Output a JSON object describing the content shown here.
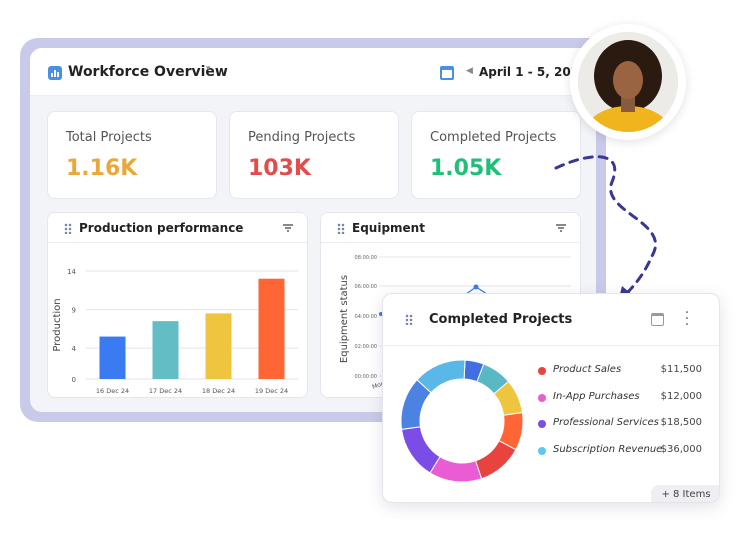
{
  "app": {
    "title": "Workforce Overview",
    "date_range": "April 1 - 5, 2025"
  },
  "stats": [
    {
      "label": "Total Projects",
      "value": "1.16K",
      "color": "#e9a93a"
    },
    {
      "label": "Pending Projects",
      "value": "103K",
      "color": "#e24c4c"
    },
    {
      "label": "Completed Projects",
      "value": "1.05K",
      "color": "#1fbf7a"
    }
  ],
  "production_panel": {
    "title": "Production performance",
    "ylabel": "Production"
  },
  "equipment_panel": {
    "title": "Equipment",
    "ylabel": "Equipment status",
    "ticks": [
      "08:00:00",
      "06:00:00",
      "04:00:00",
      "02:00:00",
      "00:00:00"
    ],
    "xtick_partial": "Mon"
  },
  "chart_data": [
    {
      "type": "bar",
      "title": "Production performance",
      "ylabel": "Production",
      "categories": [
        "16 Dec 24",
        "17 Dec 24",
        "18 Dec 24",
        "19 Dec 24"
      ],
      "values": [
        5.5,
        7.5,
        8.5,
        13
      ],
      "colors": [
        "#3a7bf2",
        "#62bdc4",
        "#efc53f",
        "#ff6535"
      ],
      "yticks": [
        0,
        4,
        9,
        14
      ],
      "ylim": [
        0,
        14
      ],
      "grid": true
    },
    {
      "type": "donut",
      "title": "Completed Projects",
      "slices": [
        {
          "color": "#3f6fe0",
          "value": 5
        },
        {
          "color": "#5ab8c5",
          "value": 8
        },
        {
          "color": "#efc53f",
          "value": 9
        },
        {
          "color": "#ff6535",
          "value": 10
        },
        {
          "color": "#e8433d",
          "value": 12
        },
        {
          "color": "#ea5cd4",
          "value": 14
        },
        {
          "color": "#7b4ce6",
          "value": 14
        },
        {
          "color": "#4c83e3",
          "value": 14
        },
        {
          "color": "#5ab8e9",
          "value": 14
        }
      ]
    }
  ],
  "completed_card": {
    "title": "Completed Projects",
    "legend": [
      {
        "name": "Product Sales",
        "amount": "$11,500",
        "color": "#e8433d"
      },
      {
        "name": "In-App Purchases",
        "amount": "$12,000",
        "color": "#ea5cd4"
      },
      {
        "name": "Professional Services",
        "amount": "$18,500",
        "color": "#7b4ce6"
      },
      {
        "name": "Subscription Revenue",
        "amount": "$36,000",
        "color": "#5ac8f0"
      }
    ],
    "more_items": "+ 8 Items"
  }
}
